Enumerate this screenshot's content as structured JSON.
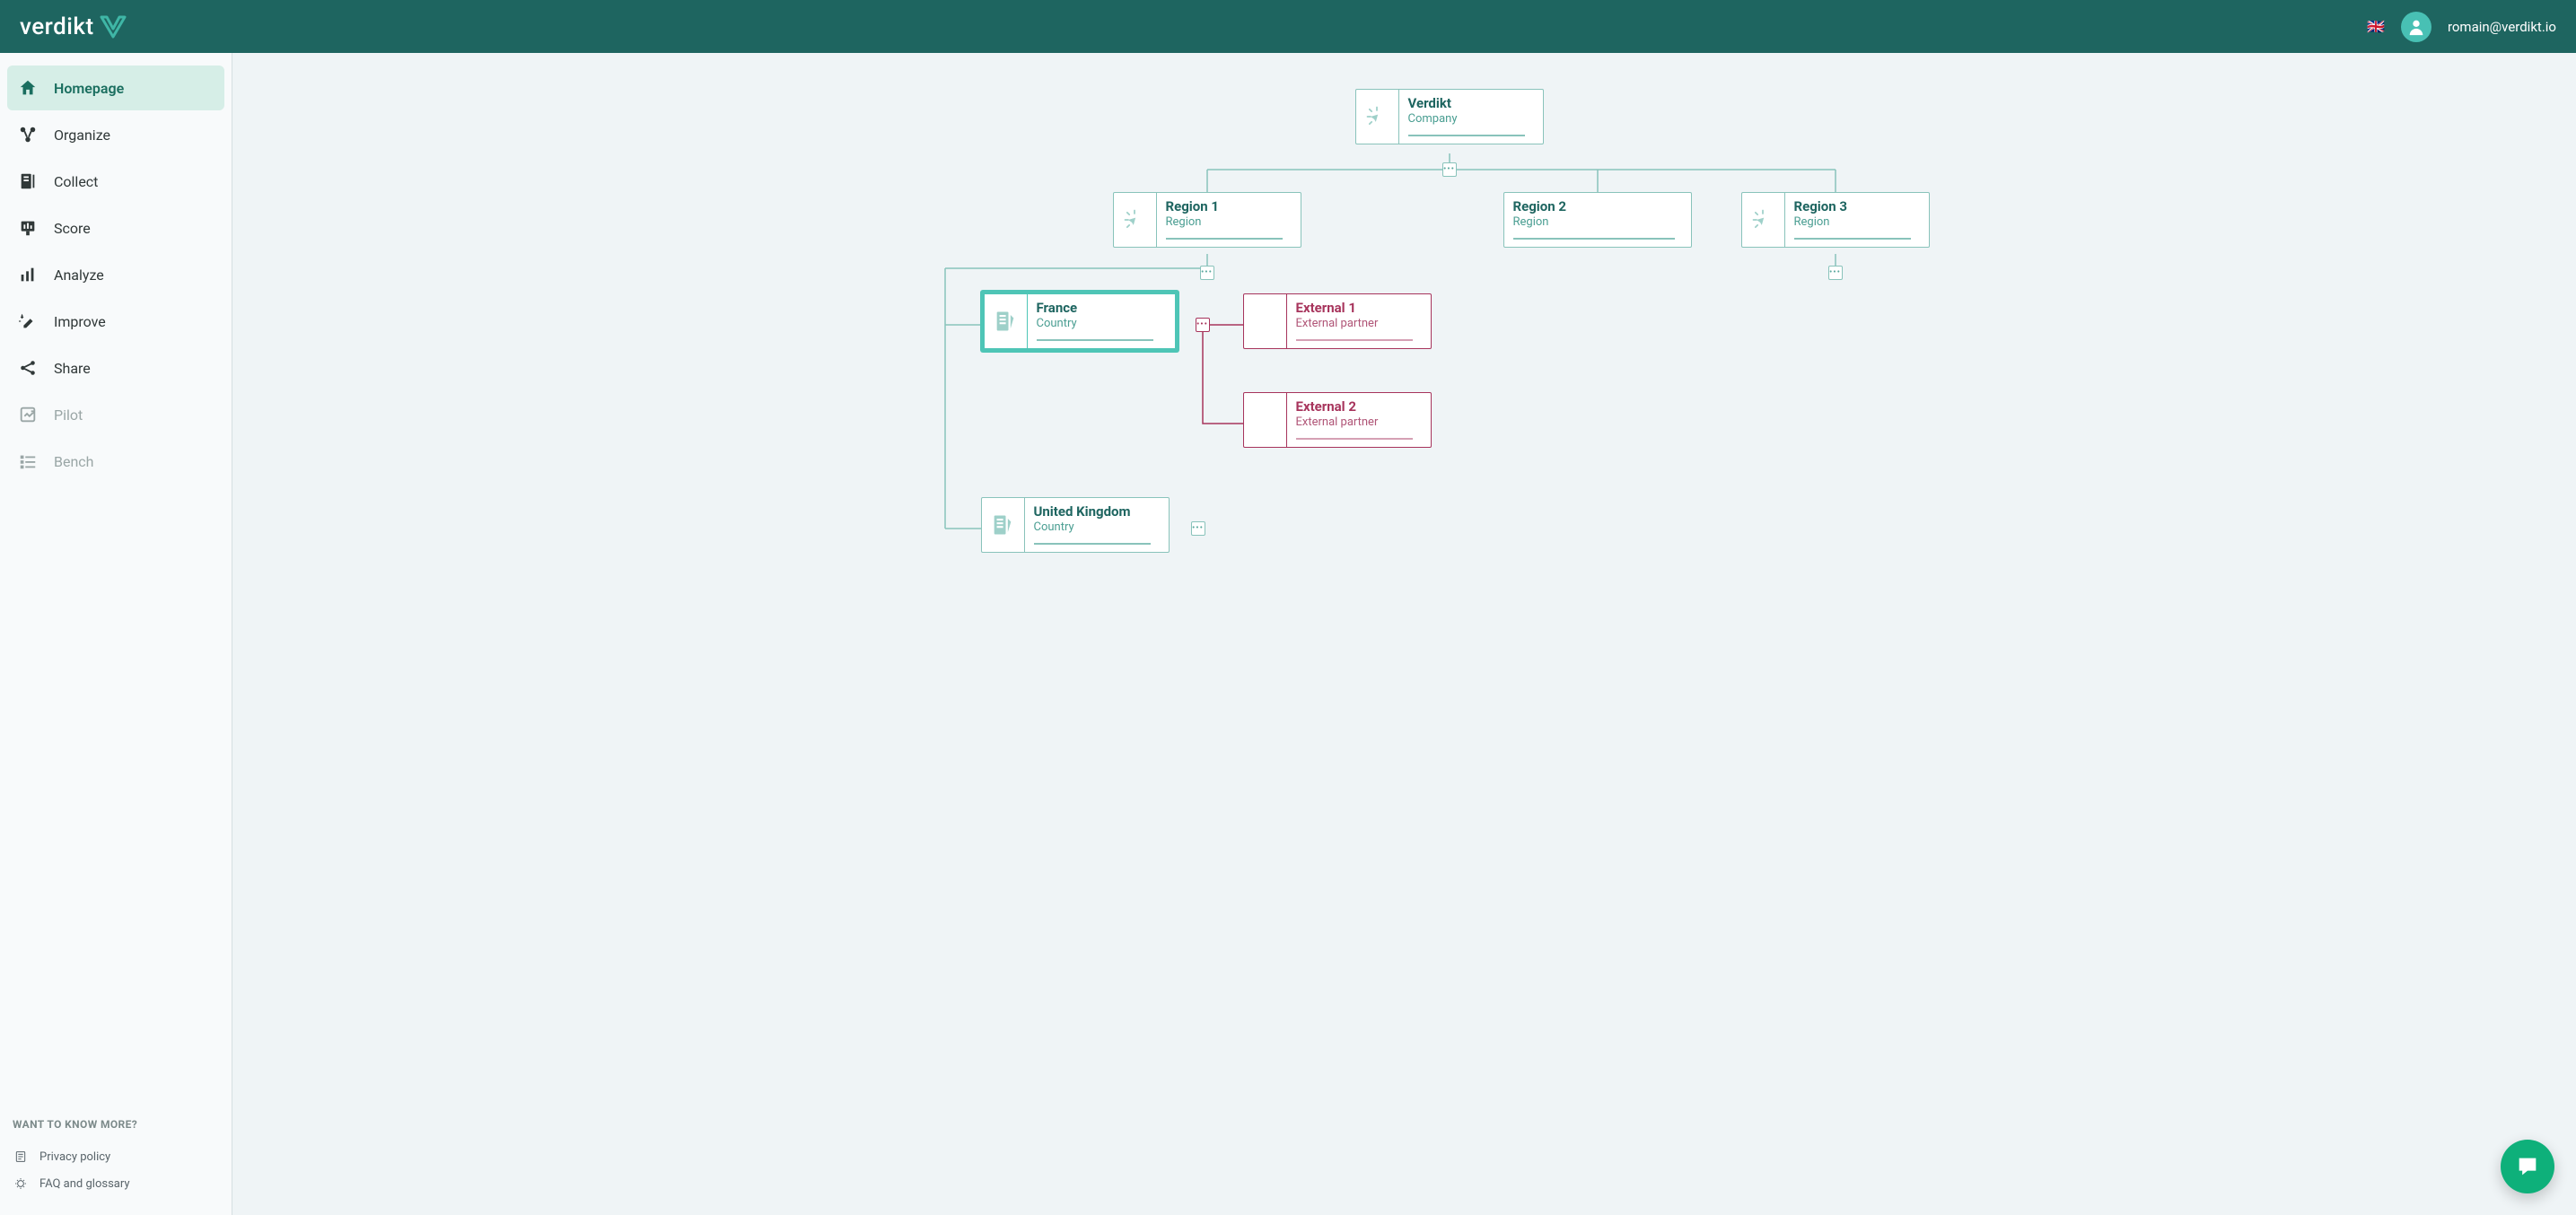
{
  "header": {
    "logo_text": "verdikt",
    "language_flag": "🇬🇧",
    "user_email": "romain@verdikt.io"
  },
  "sidebar": {
    "items": [
      {
        "label": "Homepage",
        "icon": "home-icon",
        "active": true,
        "disabled": false
      },
      {
        "label": "Organize",
        "icon": "organize-icon",
        "active": false,
        "disabled": false
      },
      {
        "label": "Collect",
        "icon": "collect-icon",
        "active": false,
        "disabled": false
      },
      {
        "label": "Score",
        "icon": "score-icon",
        "active": false,
        "disabled": false
      },
      {
        "label": "Analyze",
        "icon": "analyze-icon",
        "active": false,
        "disabled": false
      },
      {
        "label": "Improve",
        "icon": "improve-icon",
        "active": false,
        "disabled": false
      },
      {
        "label": "Share",
        "icon": "share-icon",
        "active": false,
        "disabled": false
      },
      {
        "label": "Pilot",
        "icon": "pilot-icon",
        "active": false,
        "disabled": true
      },
      {
        "label": "Bench",
        "icon": "bench-icon",
        "active": false,
        "disabled": true
      }
    ],
    "footer_heading": "WANT TO KNOW MORE?",
    "footer_links": [
      {
        "label": "Privacy policy",
        "icon": "policy-icon"
      },
      {
        "label": "FAQ and glossary",
        "icon": "faq-icon"
      }
    ]
  },
  "org_tree": {
    "root": {
      "title": "Verdikt",
      "subtitle": "Company",
      "icon": "click-icon"
    },
    "regions": [
      {
        "title": "Region 1",
        "subtitle": "Region",
        "icon": "click-icon",
        "expanded": true,
        "children": [
          {
            "title": "France",
            "subtitle": "Country",
            "icon": "document-icon",
            "selected": true,
            "expanded": true,
            "externals": [
              {
                "title": "External 1",
                "subtitle": "External partner"
              },
              {
                "title": "External 2",
                "subtitle": "External partner"
              }
            ]
          },
          {
            "title": "United Kingdom",
            "subtitle": "Country",
            "icon": "document-icon",
            "expanded": false
          }
        ]
      },
      {
        "title": "Region 2",
        "subtitle": "Region",
        "icon": null
      },
      {
        "title": "Region 3",
        "subtitle": "Region",
        "icon": "click-icon",
        "expanded": false
      }
    ]
  },
  "chat_label": "Open chat"
}
